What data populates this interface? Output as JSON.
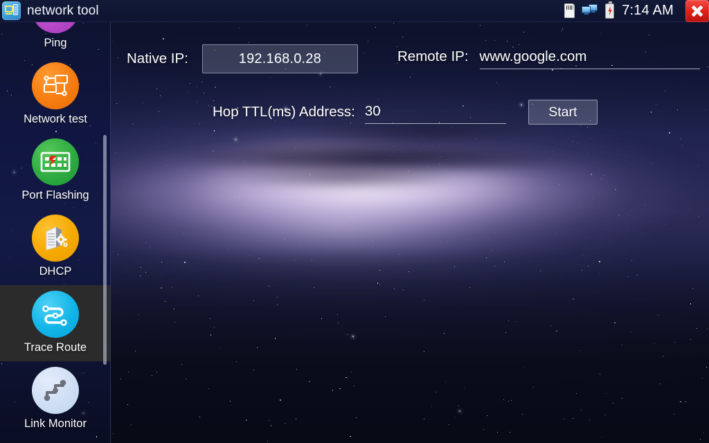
{
  "window": {
    "title": "network tool",
    "app_icon": "network-tool-icon",
    "close_label": "close-icon"
  },
  "statusbar": {
    "time": "7:14 AM",
    "icons": [
      {
        "name": "sd-card-icon"
      },
      {
        "name": "network-connection-icon"
      },
      {
        "name": "battery-charging-icon"
      }
    ]
  },
  "sidebar": {
    "selected": "Trace Route",
    "items": [
      {
        "label": "Ping",
        "icon": "ping-icon",
        "color": "#b849c9",
        "selected": false
      },
      {
        "label": "Network test",
        "icon": "network-test-icon",
        "color": "#f57c10",
        "selected": false
      },
      {
        "label": "Port Flashing",
        "icon": "port-flashing-icon",
        "color": "#2eab42",
        "selected": false
      },
      {
        "label": "DHCP",
        "icon": "dhcp-server-icon",
        "color": "#f5a900",
        "selected": false
      },
      {
        "label": "Trace Route",
        "icon": "trace-route-icon",
        "color": "#12b4e8",
        "selected": true
      },
      {
        "label": "Link Monitor",
        "icon": "link-monitor-icon",
        "color": "#cfdef4",
        "selected": false
      }
    ]
  },
  "form": {
    "native_ip": {
      "label": "Native IP:",
      "value": "192.168.0.28"
    },
    "remote_ip": {
      "label": "Remote IP:",
      "value": "www.google.com",
      "placeholder": "www.google.com"
    },
    "hop_ttl": {
      "label": "Hop TTL(ms) Address:",
      "value": "30",
      "placeholder": "30"
    },
    "start_button": {
      "label": "Start"
    }
  }
}
